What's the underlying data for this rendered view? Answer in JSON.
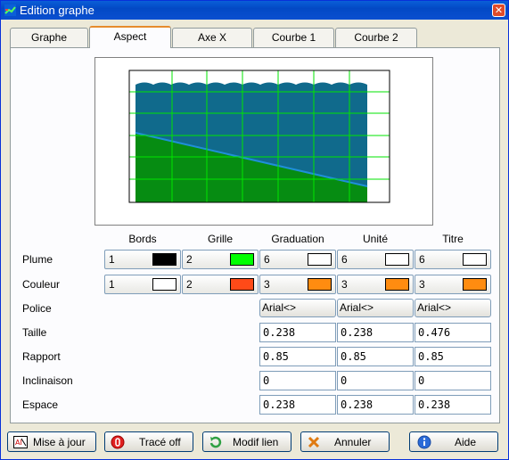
{
  "window": {
    "title": "Edition graphe",
    "close_label": "✕"
  },
  "tabs": [
    "Graphe",
    "Aspect",
    "Axe X",
    "Courbe 1",
    "Courbe 2"
  ],
  "active_tab": "Aspect",
  "preview": {
    "fill_top": "#106a8c",
    "fill_bottom": "#068c12",
    "grid_color": "#00e600",
    "line_color": "#1f8fd8"
  },
  "table": {
    "columns": [
      "Bords",
      "Grille",
      "Graduation",
      "Unité",
      "Titre"
    ],
    "rows": {
      "plume": {
        "label": "Plume",
        "cells": [
          {
            "num": "1",
            "color": "#000000"
          },
          {
            "num": "2",
            "color": "#00ff00"
          },
          {
            "num": "6",
            "color": "#ffffff"
          },
          {
            "num": "6",
            "color": "#ffffff"
          },
          {
            "num": "6",
            "color": "#ffffff"
          }
        ]
      },
      "couleur": {
        "label": "Couleur",
        "cells": [
          {
            "num": "1",
            "color": "#ffffff"
          },
          {
            "num": "2",
            "color": "#ff4a18"
          },
          {
            "num": "3",
            "color": "#ff8c10"
          },
          {
            "num": "3",
            "color": "#ff8c10"
          },
          {
            "num": "3",
            "color": "#ff8c10"
          }
        ]
      },
      "police": {
        "label": "Police",
        "values": [
          "Arial<>",
          "Arial<>",
          "Arial<>"
        ]
      },
      "taille": {
        "label": "Taille",
        "values": [
          "0.238",
          "0.238",
          "0.476"
        ]
      },
      "rapport": {
        "label": "Rapport",
        "values": [
          "0.85",
          "0.85",
          "0.85"
        ]
      },
      "inclinaison": {
        "label": "Inclinaison",
        "values": [
          "0",
          "0",
          "0"
        ]
      },
      "espace": {
        "label": "Espace",
        "values": [
          "0.238",
          "0.238",
          "0.238"
        ]
      }
    }
  },
  "buttons": {
    "update": "Mise à jour",
    "trace_off": "Tracé off",
    "modif_lien": "Modif lien",
    "cancel": "Annuler",
    "help": "Aide"
  }
}
